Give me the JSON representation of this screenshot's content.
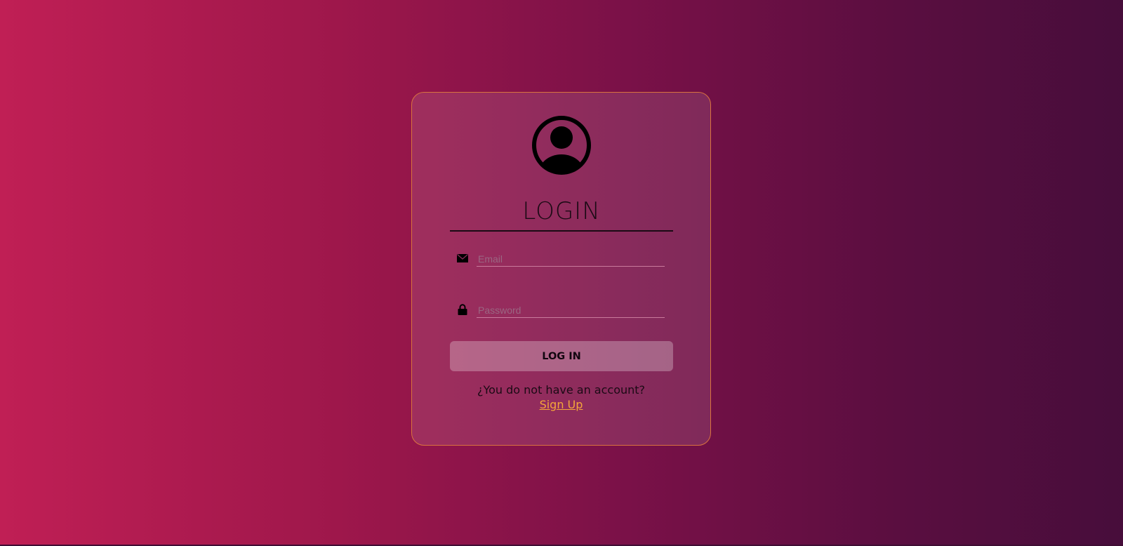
{
  "page": {
    "background_colors": [
      "#c01f55",
      "#470d3b"
    ],
    "accent_border": "#d9733f",
    "link_color": "#f4a63a"
  },
  "login_card": {
    "avatar_icon": "user-circle-icon",
    "title": "LOGIN",
    "email": {
      "icon": "envelope-icon",
      "placeholder": "Email",
      "value": ""
    },
    "password": {
      "icon": "lock-icon",
      "placeholder": "Password",
      "value": ""
    },
    "submit_label": "LOG IN",
    "signup_prompt": "¿You do not have an account?",
    "signup_link": "Sign Up"
  }
}
